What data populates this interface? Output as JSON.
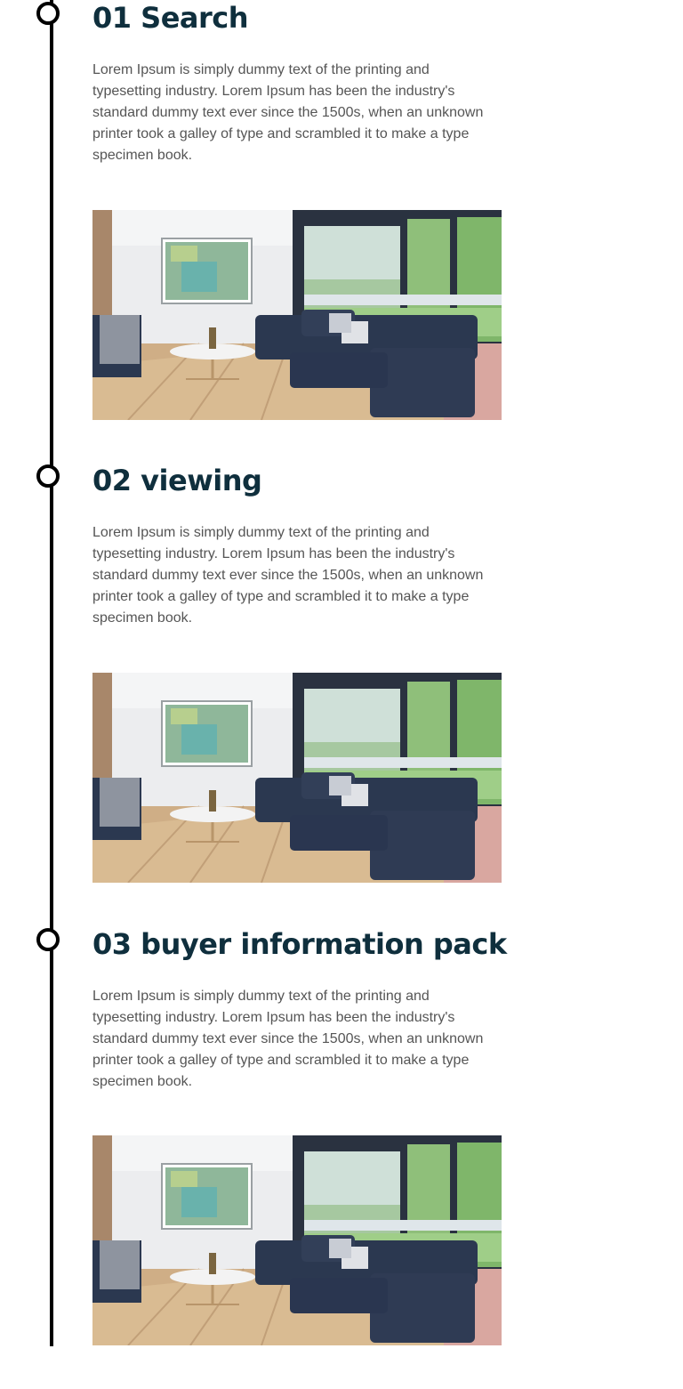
{
  "timeline": {
    "steps": [
      {
        "title": "01 Search",
        "description": "Lorem Ipsum is simply dummy text of the printing and typesetting industry. Lorem Ipsum has been the industry's standard dummy text ever since the 1500s, when an unknown printer took a galley of type and scrambled it to make a type specimen book."
      },
      {
        "title": "02 viewing",
        "description": "Lorem Ipsum is simply dummy text of the printing and typesetting industry. Lorem Ipsum has been the industry's standard dummy text ever since the 1500s, when an unknown printer took a galley of type and scrambled it to make a type specimen book."
      },
      {
        "title": "03 buyer information pack",
        "description": "Lorem Ipsum is simply dummy text of the printing and typesetting industry. Lorem Ipsum has been the industry's standard dummy text ever since the 1500s, when an unknown printer took a galley of type and scrambled it to make a type specimen book."
      }
    ]
  },
  "colors": {
    "heading": "#0f2f3d",
    "body_text": "#555555",
    "timeline": "#000000"
  }
}
